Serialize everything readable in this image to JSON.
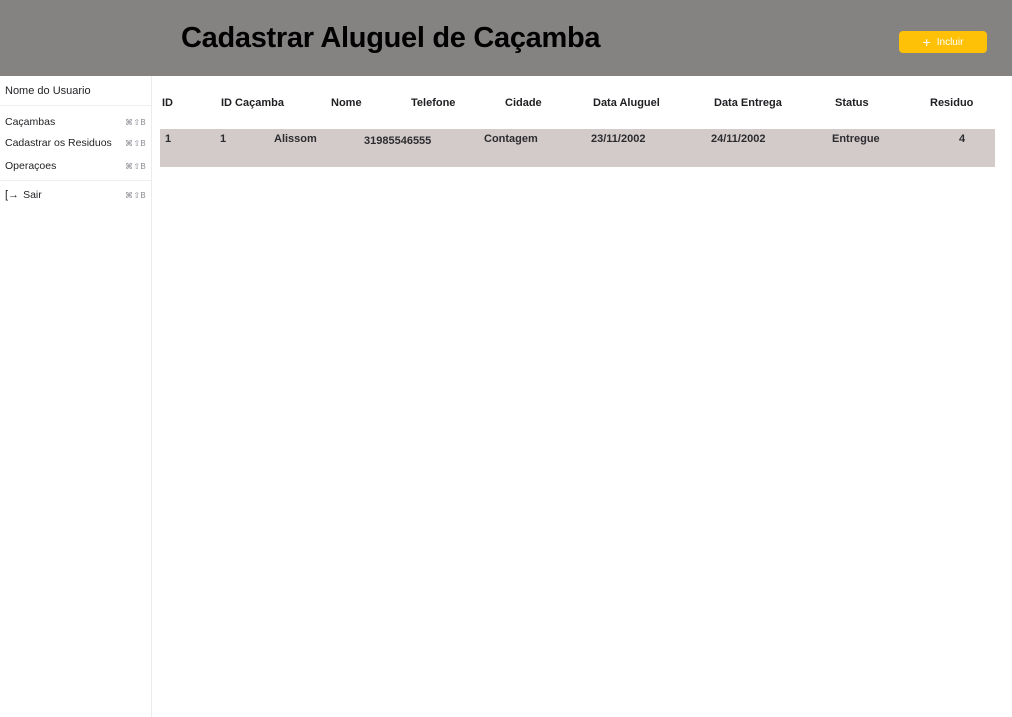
{
  "header": {
    "title": "Cadastrar Aluguel de Caçamba",
    "add_button": {
      "icon": "plus-icon",
      "label": "Incluir"
    }
  },
  "colors": {
    "header_bg": "#858282",
    "accent": "#ffc107",
    "row_bg": "#d3cbca"
  },
  "sidebar": {
    "user_name": "Nome do Usuario",
    "items": [
      {
        "label": "Caçambas",
        "shortcut": "⌘⇧B"
      },
      {
        "label": "Cadastrar os Residuos",
        "shortcut": "⌘⇧B"
      },
      {
        "label": "Operaçoes",
        "shortcut": "⌘⇧B"
      },
      {
        "label": "Sair",
        "shortcut": "⌘⇧B",
        "icon": "log-out-icon"
      }
    ]
  },
  "table": {
    "columns": [
      "ID",
      "ID Caçamba",
      "Nome",
      "Telefone",
      "Cidade",
      "Data Aluguel",
      "Data Entrega",
      "Status",
      "Residuo"
    ],
    "rows": [
      [
        "1",
        "1",
        "Alissom",
        "31985546555",
        "Contagem",
        "23/11/2002",
        "24/11/2002",
        "Entregue",
        "4"
      ]
    ]
  }
}
